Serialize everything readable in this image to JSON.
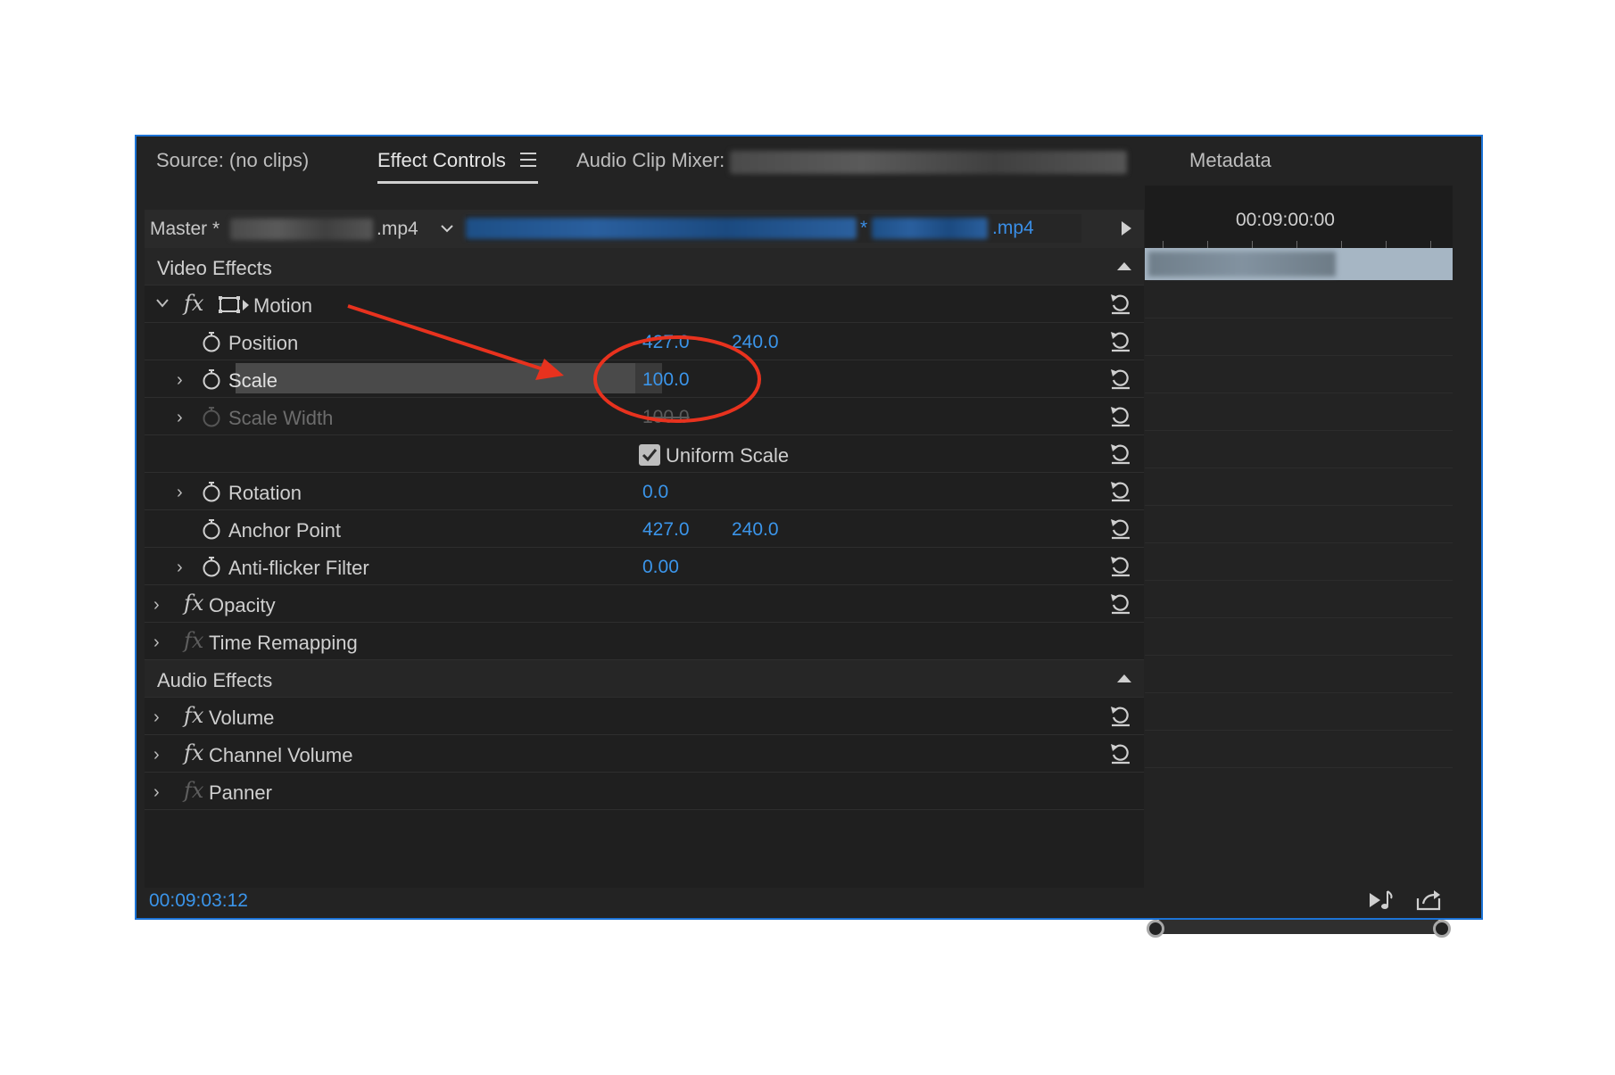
{
  "tabs": {
    "source": "Source: (no clips)",
    "effect_controls": "Effect Controls",
    "audio_clip_mixer": "Audio Clip Mixer:",
    "metadata": "Metadata"
  },
  "clip_header": {
    "master_label": "Master *",
    "master_ext": ".mp4",
    "seq_star": "*",
    "seq_ext": ".mp4"
  },
  "sections": {
    "video_effects": "Video Effects",
    "audio_effects": "Audio Effects"
  },
  "motion": {
    "label": "Motion",
    "position": {
      "label": "Position",
      "x": "427.0",
      "y": "240.0"
    },
    "scale": {
      "label": "Scale",
      "value": "100.0"
    },
    "scale_width": {
      "label": "Scale Width",
      "value": "100.0"
    },
    "uniform_scale": {
      "label": "Uniform Scale",
      "checked": true
    },
    "rotation": {
      "label": "Rotation",
      "value": "0.0"
    },
    "anchor_point": {
      "label": "Anchor Point",
      "x": "427.0",
      "y": "240.0"
    },
    "anti_flicker": {
      "label": "Anti-flicker Filter",
      "value": "0.00"
    }
  },
  "video_rows": {
    "opacity": "Opacity",
    "time_remapping": "Time Remapping"
  },
  "audio_rows": {
    "volume": "Volume",
    "channel_volume": "Channel Volume",
    "panner": "Panner"
  },
  "timeline": {
    "timecode": "00:09:00:00"
  },
  "footer": {
    "timecode": "00:09:03:12"
  },
  "colors": {
    "accent_blue": "#3b95ea",
    "panel_border": "#1c73d6",
    "annotation_red": "#e8321e"
  }
}
